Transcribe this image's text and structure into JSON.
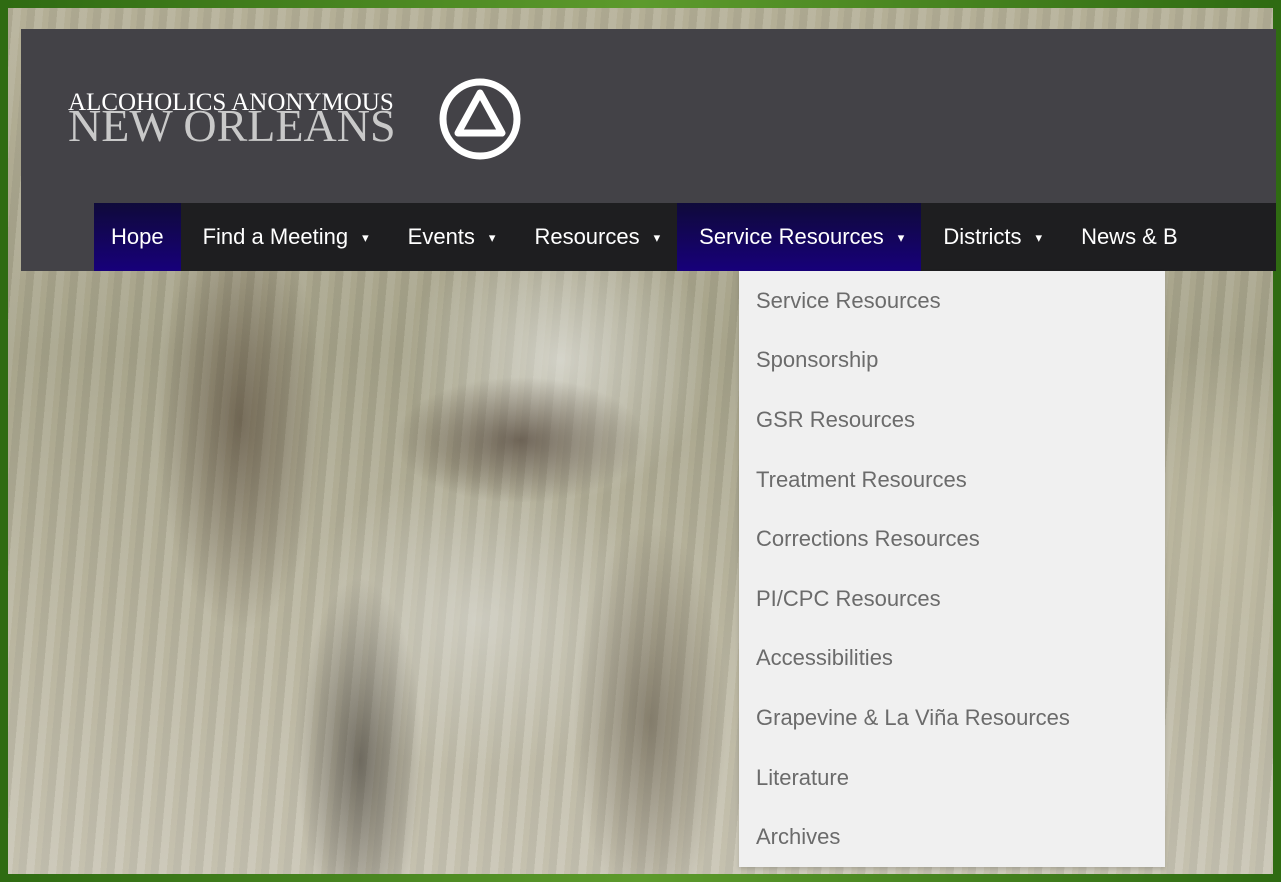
{
  "site": {
    "logo_line1": "ALCOHOLICS ANONYMOUS",
    "logo_line2": "NEW ORLEANS",
    "logo_symbol": "circle-triangle-icon"
  },
  "nav": {
    "items": [
      {
        "label": "Hope",
        "has_dropdown": false,
        "active": true
      },
      {
        "label": "Find a Meeting",
        "has_dropdown": true,
        "active": false
      },
      {
        "label": "Events",
        "has_dropdown": true,
        "active": false
      },
      {
        "label": "Resources",
        "has_dropdown": true,
        "active": false
      },
      {
        "label": "Service Resources",
        "has_dropdown": true,
        "active": true
      },
      {
        "label": "Districts",
        "has_dropdown": true,
        "active": false
      },
      {
        "label": "News & B",
        "has_dropdown": false,
        "active": false
      }
    ],
    "caret": "▾"
  },
  "dropdown": {
    "items": [
      "Service Resources",
      "Sponsorship",
      "GSR Resources",
      "Treatment Resources",
      "Corrections Resources",
      "PI/CPC Resources",
      "Accessibilities",
      "Grapevine & La Viña Resources",
      "Literature",
      "Archives"
    ]
  },
  "colors": {
    "header_bg": "#434247",
    "nav_bg": "#1e1e20",
    "nav_active": "#17007a",
    "dropdown_bg": "#f0f0f0",
    "dropdown_text": "#6b6b6b"
  }
}
